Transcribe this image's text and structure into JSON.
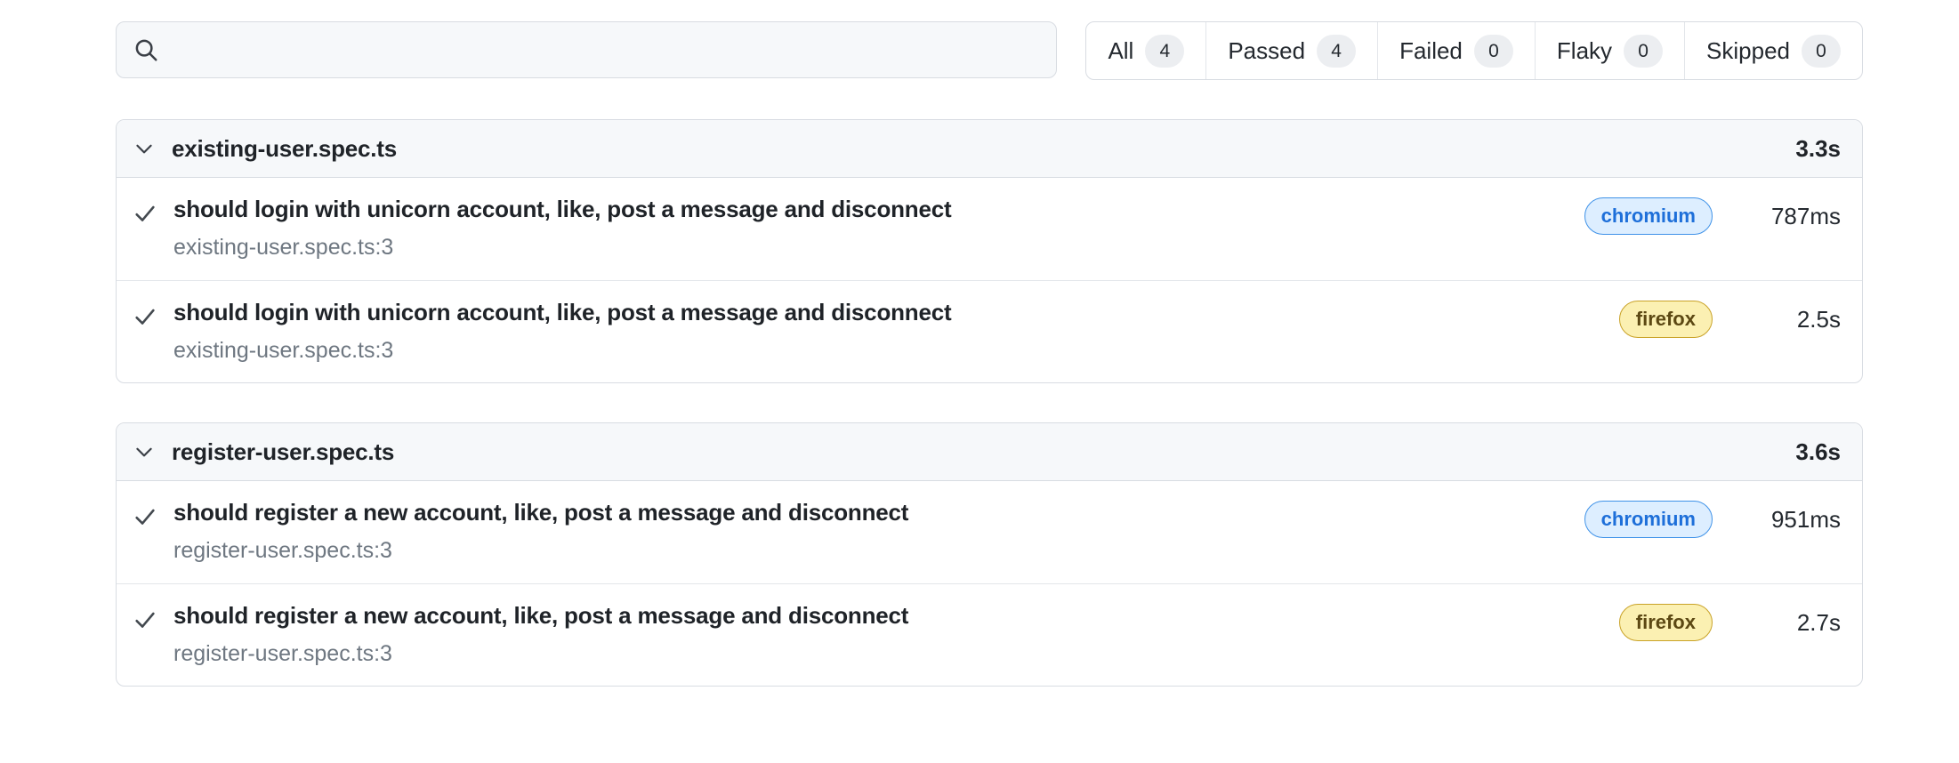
{
  "search": {
    "value": "",
    "placeholder": "",
    "icon": "search-icon"
  },
  "filters": [
    {
      "label": "All",
      "count": "4"
    },
    {
      "label": "Passed",
      "count": "4"
    },
    {
      "label": "Failed",
      "count": "0"
    },
    {
      "label": "Flaky",
      "count": "0"
    },
    {
      "label": "Skipped",
      "count": "0"
    }
  ],
  "colors": {
    "card_border": "#d8dce2",
    "header_bg": "#f6f8fa",
    "text": "#1f2328",
    "muted_text": "#6e7781",
    "chromium_bg": "#ddeeff",
    "chromium_border": "#3f92e8",
    "chromium_text": "#1e6fd9",
    "firefox_bg": "#fbf0b2",
    "firefox_border": "#c9a227",
    "firefox_text": "#5c4813"
  },
  "groups": [
    {
      "file": "existing-user.spec.ts",
      "duration": "3.3s",
      "collapse_icon": "chevron-down-icon",
      "tests": [
        {
          "status_icon": "check-icon",
          "title": "should login with unicorn account, like, post a message and disconnect",
          "location": "existing-user.spec.ts:3",
          "browser": "chromium",
          "duration": "787ms"
        },
        {
          "status_icon": "check-icon",
          "title": "should login with unicorn account, like, post a message and disconnect",
          "location": "existing-user.spec.ts:3",
          "browser": "firefox",
          "duration": "2.5s"
        }
      ]
    },
    {
      "file": "register-user.spec.ts",
      "duration": "3.6s",
      "collapse_icon": "chevron-down-icon",
      "tests": [
        {
          "status_icon": "check-icon",
          "title": "should register a new account, like, post a message and disconnect",
          "location": "register-user.spec.ts:3",
          "browser": "chromium",
          "duration": "951ms"
        },
        {
          "status_icon": "check-icon",
          "title": "should register a new account, like, post a message and disconnect",
          "location": "register-user.spec.ts:3",
          "browser": "firefox",
          "duration": "2.7s"
        }
      ]
    }
  ]
}
